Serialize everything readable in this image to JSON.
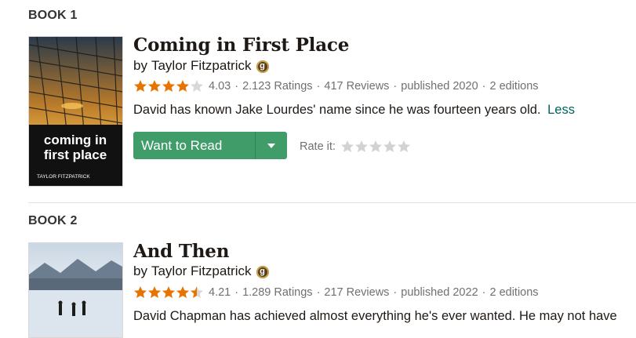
{
  "books": [
    {
      "label": "BOOK 1",
      "title": "Coming in First Place",
      "by": "by",
      "author": "Taylor Fitzpatrick",
      "rating_value": 4.03,
      "rating": "4.03",
      "ratings": "2.123 Ratings",
      "reviews": "417 Reviews",
      "published": "published 2020",
      "editions": "2 editions",
      "description": "David has known Jake Lourdes' name since he was fourteen years old.",
      "less": "Less",
      "cover_title": "coming in first place",
      "cover_author": "TAYLOR FITZPATRICK"
    },
    {
      "label": "BOOK 2",
      "title": "And Then",
      "by": "by",
      "author": "Taylor Fitzpatrick",
      "rating_value": 4.21,
      "rating": "4.21",
      "ratings": "1.289 Ratings",
      "reviews": "217 Reviews",
      "published": "published 2022",
      "editions": "2 editions",
      "description": "David Chapman has achieved almost everything he's ever wanted. He may not have"
    }
  ],
  "want_to_read": "Want to Read",
  "rate_it": "Rate it:",
  "badge_letter": "g",
  "colors": {
    "green": "#409d69",
    "star_orange": "#e87400",
    "link_teal": "#00635d"
  }
}
